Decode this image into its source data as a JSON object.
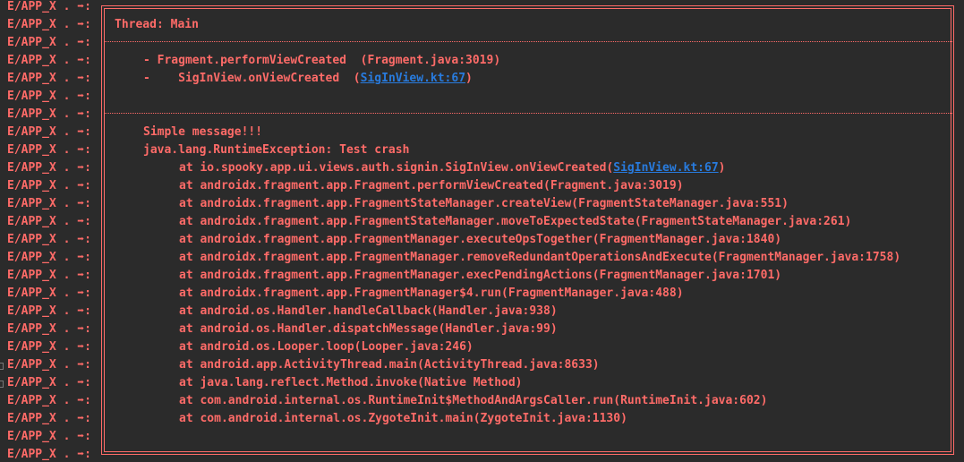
{
  "log_tag": "E/APP_X . ➡:",
  "thread_title": "Thread: Main",
  "method_lines": [
    {
      "text": "- Fragment.performViewCreated  (Fragment.java:3019)",
      "link": null,
      "suffix": null
    },
    {
      "text": "-    SigInView.onViewCreated  (",
      "link": "SigInView.kt:67",
      "suffix": ")"
    }
  ],
  "message": "Simple message!!!",
  "exception": "java.lang.RuntimeException: Test crash",
  "stack_trace": [
    {
      "text": "at io.spooky.app.ui.views.auth.signin.SigInView.onViewCreated(",
      "link": "SigInView.kt:67",
      "suffix": ")"
    },
    {
      "text": "at androidx.fragment.app.Fragment.performViewCreated(Fragment.java:3019)",
      "link": null,
      "suffix": null
    },
    {
      "text": "at androidx.fragment.app.FragmentStateManager.createView(FragmentStateManager.java:551)",
      "link": null,
      "suffix": null
    },
    {
      "text": "at androidx.fragment.app.FragmentStateManager.moveToExpectedState(FragmentStateManager.java:261)",
      "link": null,
      "suffix": null
    },
    {
      "text": "at androidx.fragment.app.FragmentManager.executeOpsTogether(FragmentManager.java:1840)",
      "link": null,
      "suffix": null
    },
    {
      "text": "at androidx.fragment.app.FragmentManager.removeRedundantOperationsAndExecute(FragmentManager.java:1758)",
      "link": null,
      "suffix": null
    },
    {
      "text": "at androidx.fragment.app.FragmentManager.execPendingActions(FragmentManager.java:1701)",
      "link": null,
      "suffix": null
    },
    {
      "text": "at androidx.fragment.app.FragmentManager$4.run(FragmentManager.java:488)",
      "link": null,
      "suffix": null
    },
    {
      "text": "at android.os.Handler.handleCallback(Handler.java:938)",
      "link": null,
      "suffix": null
    },
    {
      "text": "at android.os.Handler.dispatchMessage(Handler.java:99)",
      "link": null,
      "suffix": null
    },
    {
      "text": "at android.os.Looper.loop(Looper.java:246)",
      "link": null,
      "suffix": null
    },
    {
      "text": "at android.app.ActivityThread.main(ActivityThread.java:8633)",
      "link": null,
      "suffix": null
    },
    {
      "text": "at java.lang.reflect.Method.invoke(Native Method)",
      "link": null,
      "suffix": null
    },
    {
      "text": "at com.android.internal.os.RuntimeInit$MethodAndArgsCaller.run(RuntimeInit.java:602)",
      "link": null,
      "suffix": null
    },
    {
      "text": "at com.android.internal.os.ZygoteInit.main(ZygoteInit.java:1130)",
      "link": null,
      "suffix": null
    }
  ],
  "colors": {
    "background": "#2b2b2b",
    "error_text": "#ff6b68",
    "link": "#287bde"
  }
}
